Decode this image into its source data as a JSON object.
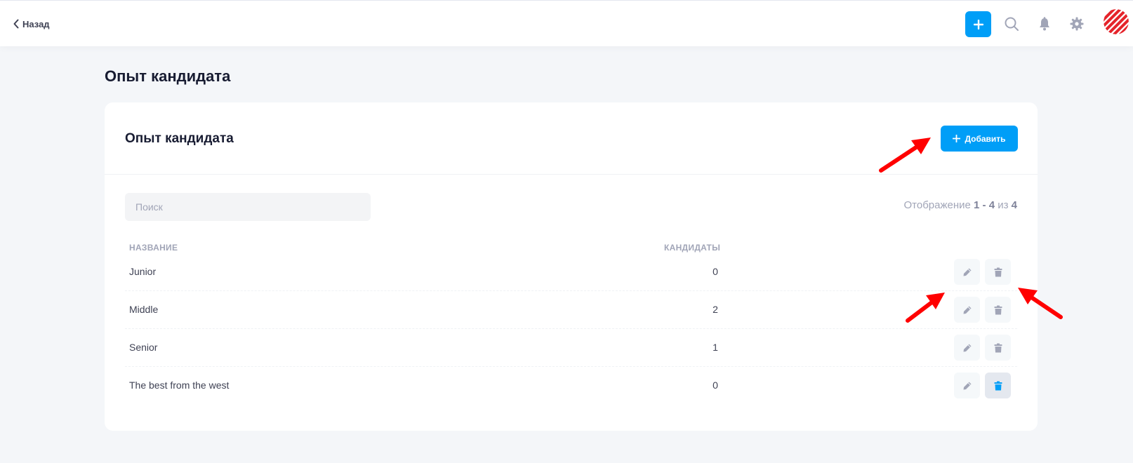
{
  "topbar": {
    "back_label": "Назад"
  },
  "page": {
    "title": "Опыт кандидата"
  },
  "card": {
    "title": "Опыт кандидата",
    "add_label": "Добавить",
    "search_placeholder": "Поиск",
    "showing_prefix": "Отображение",
    "showing_range": "1 - 4",
    "showing_of": "из",
    "showing_total": "4"
  },
  "table": {
    "headers": [
      "НАЗВАНИЕ",
      "КАНДИДАТЫ"
    ],
    "rows": [
      {
        "name": "Junior",
        "count": "0"
      },
      {
        "name": "Middle",
        "count": "2"
      },
      {
        "name": "Senior",
        "count": "1"
      },
      {
        "name": "The best from the west",
        "count": "0"
      }
    ]
  },
  "colors": {
    "primary": "#009ef7",
    "arrow": "#ff0000",
    "icon_gray": "#a1a5b7"
  },
  "icons": {
    "back": "chevron-left-icon",
    "add": "plus-icon",
    "search": "search-icon",
    "notifications": "bell-icon",
    "settings": "gear-icon",
    "edit": "pencil-icon",
    "delete": "trash-icon"
  }
}
